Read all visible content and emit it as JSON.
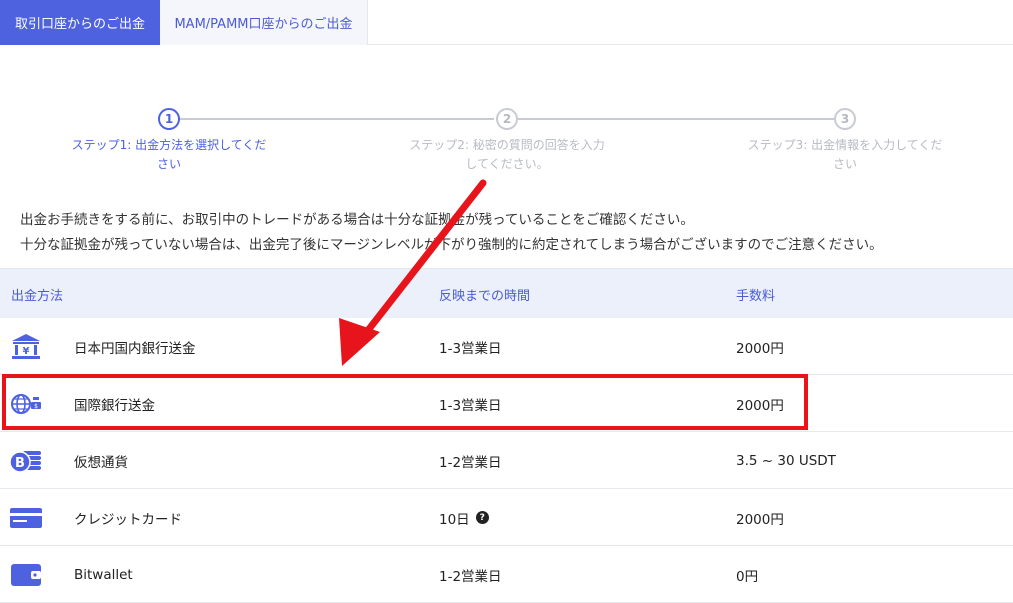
{
  "tabs": [
    {
      "label": "取引口座からのご出金",
      "active": true
    },
    {
      "label": "MAM/PAMM口座からのご出金",
      "active": false
    }
  ],
  "stepper": {
    "steps": [
      {
        "number": "1",
        "label_line1": "ステップ1: 出金方法を選択してくだ",
        "label_line2": "さい",
        "active": true
      },
      {
        "number": "2",
        "label_line1": "ステップ2: 秘密の質問の回答を入力",
        "label_line2": "してください。",
        "active": false
      },
      {
        "number": "3",
        "label_line1": "ステップ3: 出金情報を入力してくだ",
        "label_line2": "さい",
        "active": false
      }
    ]
  },
  "notice": {
    "line1": "出金お手続きをする前に、お取引中のトレードがある場合は十分な証拠金が残っていることをご確認ください。",
    "line2": "十分な証拠金が残っていない場合は、出金完了後にマージンレベルが下がり強制的に約定されてしまう場合がございますのでご注意ください。"
  },
  "table": {
    "headers": {
      "method": "出金方法",
      "time": "反映までの時間",
      "fee": "手数料"
    },
    "rows": [
      {
        "icon": "bank-yen-icon",
        "name": "日本円国内銀行送金",
        "time": "1-3営業日",
        "fee": "2000円"
      },
      {
        "icon": "globe-money-icon",
        "name": "国際銀行送金",
        "time": "1-3営業日",
        "fee": "2000円"
      },
      {
        "icon": "bitcoin-coins-icon",
        "name": "仮想通貨",
        "time": "1-2営業日",
        "fee": "3.5 ~ 30 USDT"
      },
      {
        "icon": "credit-card-icon",
        "name": "クレジットカード",
        "time": "10日",
        "fee": "2000円",
        "help": "?"
      },
      {
        "icon": "wallet-icon",
        "name": "Bitwallet",
        "time": "1-2営業日",
        "fee": "0円"
      }
    ]
  },
  "colors": {
    "accent": "#4e62e0",
    "highlight": "#e8141b",
    "header_bg": "#ebf0fb"
  }
}
